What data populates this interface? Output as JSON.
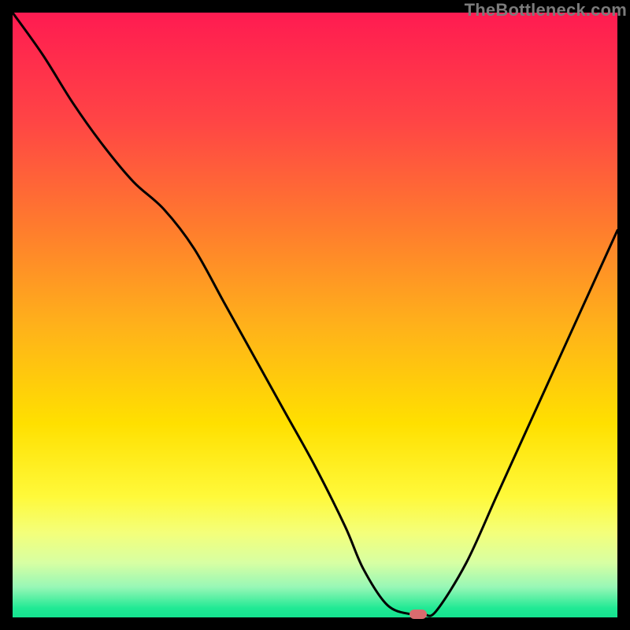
{
  "watermark": "TheBottleneck.com",
  "colors": {
    "marker": "#d96b6e",
    "curve_stroke": "#000000",
    "gradient_stops": [
      {
        "offset": 0.0,
        "color": "#ff1b51"
      },
      {
        "offset": 0.18,
        "color": "#ff4545"
      },
      {
        "offset": 0.35,
        "color": "#ff7a2e"
      },
      {
        "offset": 0.52,
        "color": "#ffb21a"
      },
      {
        "offset": 0.68,
        "color": "#ffe000"
      },
      {
        "offset": 0.8,
        "color": "#fff93a"
      },
      {
        "offset": 0.86,
        "color": "#f4ff7a"
      },
      {
        "offset": 0.91,
        "color": "#d7ffa3"
      },
      {
        "offset": 0.95,
        "color": "#97f7b6"
      },
      {
        "offset": 0.985,
        "color": "#20e994"
      },
      {
        "offset": 1.0,
        "color": "#15e28f"
      }
    ]
  },
  "chart_data": {
    "type": "line",
    "title": "",
    "xlabel": "",
    "ylabel": "",
    "xlim": [
      0,
      100
    ],
    "ylim": [
      0,
      100
    ],
    "x": [
      0,
      5,
      10,
      15,
      20,
      25,
      30,
      35,
      40,
      45,
      50,
      55,
      58,
      62,
      66,
      68,
      70,
      75,
      80,
      85,
      90,
      95,
      100
    ],
    "values": [
      100,
      93,
      85,
      78,
      72,
      67.5,
      61,
      52,
      43,
      34,
      25,
      15,
      8,
      2,
      0.5,
      0.5,
      1,
      9,
      20,
      31,
      42,
      53,
      64
    ],
    "flat_range_x": [
      62,
      68
    ],
    "marker": {
      "x": 67,
      "y": 0.5
    }
  }
}
